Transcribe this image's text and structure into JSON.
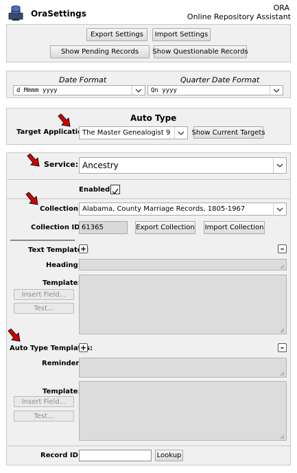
{
  "header": {
    "app_title": "OraSettings",
    "brand_short": "ORA",
    "brand_long": "Online Repository Assistant"
  },
  "settings_buttons": {
    "export": "Export Settings",
    "import": "Import Settings",
    "pending": "Show Pending Records",
    "questionable": "Show Questionable Records"
  },
  "date_formats": {
    "date_label": "Date Format",
    "date_value": "d Mmmm yyyy",
    "quarter_label": "Quarter Date Format",
    "quarter_value": "Qn yyyy"
  },
  "auto_type": {
    "title": "Auto Type",
    "target_label": "Target Application:",
    "target_value": "The Master Genealogist 9",
    "show_targets": "Show Current Targets"
  },
  "service": {
    "label": "Service:",
    "value": "Ancestry",
    "enabled_label": "Enabled:",
    "enabled": true
  },
  "collection": {
    "label": "Collection:",
    "value": "Alabama, County Marriage Records, 1805-1967",
    "id_label": "Collection ID:",
    "id_value": "61365",
    "export": "Export Collection",
    "import": "Import Collection"
  },
  "text_templates": {
    "label": "Text Templates:",
    "heading_label": "Heading:",
    "template_label": "Template:",
    "insert_field": "Insert Field...",
    "test": "Test..."
  },
  "auto_type_templates": {
    "label": "Auto Type Templates:",
    "reminder_label": "Reminder:",
    "template_label": "Template:",
    "insert_field": "Insert Field...",
    "test": "Test..."
  },
  "record": {
    "label": "Record ID:",
    "value": "",
    "lookup": "Lookup"
  },
  "icons": {
    "app": "database-icon",
    "add": "plus-icon",
    "remove": "minus-icon",
    "dropdown": "chevron-down-icon",
    "marker": "red-arrow-icon"
  },
  "colors": {
    "marker": "#d40000",
    "panel": "#f0f0f0",
    "disabled_field": "#dcdcdc"
  }
}
